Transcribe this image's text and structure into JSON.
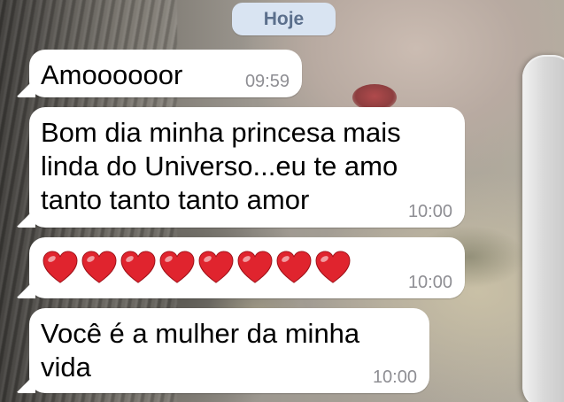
{
  "date_separator": "Hoje",
  "messages": [
    {
      "text": "Amoooooor",
      "time": "09:59"
    },
    {
      "text": "Bom dia minha princesa mais\nlinda do Universo...eu te amo\ntanto tanto tanto amor",
      "time": "10:00"
    },
    {
      "emoji": "red-heart",
      "count": 8,
      "time": "10:00"
    },
    {
      "text": "Você é a mulher da minha\nvida",
      "time": "10:00"
    }
  ],
  "colors": {
    "bubble": "#ffffff",
    "timestamp": "#8e8e93",
    "date_pill_bg": "#d9e4f2",
    "date_pill_text": "#5b6f8c",
    "heart": "#e0242e"
  }
}
